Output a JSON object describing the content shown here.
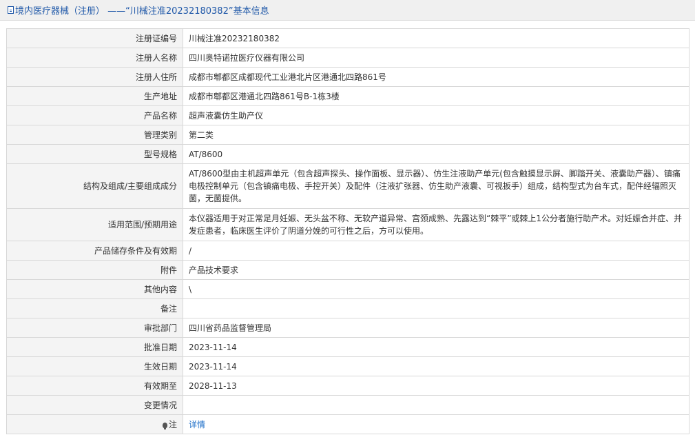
{
  "header": {
    "title": "境内医疗器械（注册） ——“川械注准20232180382”基本信息"
  },
  "rows": [
    {
      "label": "注册证编号",
      "value": "川械注准20232180382"
    },
    {
      "label": "注册人名称",
      "value": "四川奥特诺拉医疗仪器有限公司"
    },
    {
      "label": "注册人住所",
      "value": "成都市郫都区成都现代工业港北片区港通北四路861号"
    },
    {
      "label": "生产地址",
      "value": "成都市郫都区港通北四路861号B-1栋3楼"
    },
    {
      "label": "产品名称",
      "value": "超声液囊仿生助产仪"
    },
    {
      "label": "管理类别",
      "value": "第二类"
    },
    {
      "label": "型号规格",
      "value": "AT/8600"
    },
    {
      "label": "结构及组成/主要组成成分",
      "value": "AT/8600型由主机超声单元（包含超声探头、操作面板、显示器）、仿生注液助产单元(包含触摸显示屏、脚踏开关、液囊助产器）、镇痛电极控制单元（包含镇痛电极、手控开关）及配件（注液扩张器、仿生助产液囊、可视扳手）组成，结构型式为台车式，配件经辐照灭菌，无菌提供。"
    },
    {
      "label": "适用范围/预期用途",
      "value": "本仪器适用于对正常足月妊娠、无头盆不称、无软产道异常、宫颈成熟、先露达到“棘平”或棘上1公分者施行助产术。对妊娠合并症、并发症患者，临床医生评价了阴道分娩的可行性之后，方可以使用。"
    },
    {
      "label": "产品储存条件及有效期",
      "value": "/"
    },
    {
      "label": "附件",
      "value": "产品技术要求"
    },
    {
      "label": "其他内容",
      "value": "\\"
    },
    {
      "label": "备注",
      "value": ""
    },
    {
      "label": "审批部门",
      "value": "四川省药品监督管理局"
    },
    {
      "label": "批准日期",
      "value": "2023-11-14"
    },
    {
      "label": "生效日期",
      "value": "2023-11-14"
    },
    {
      "label": "有效期至",
      "value": "2028-11-13"
    },
    {
      "label": "变更情况",
      "value": ""
    }
  ],
  "note": {
    "label": "注",
    "icon": "bulb-icon",
    "link_text": "详情"
  }
}
